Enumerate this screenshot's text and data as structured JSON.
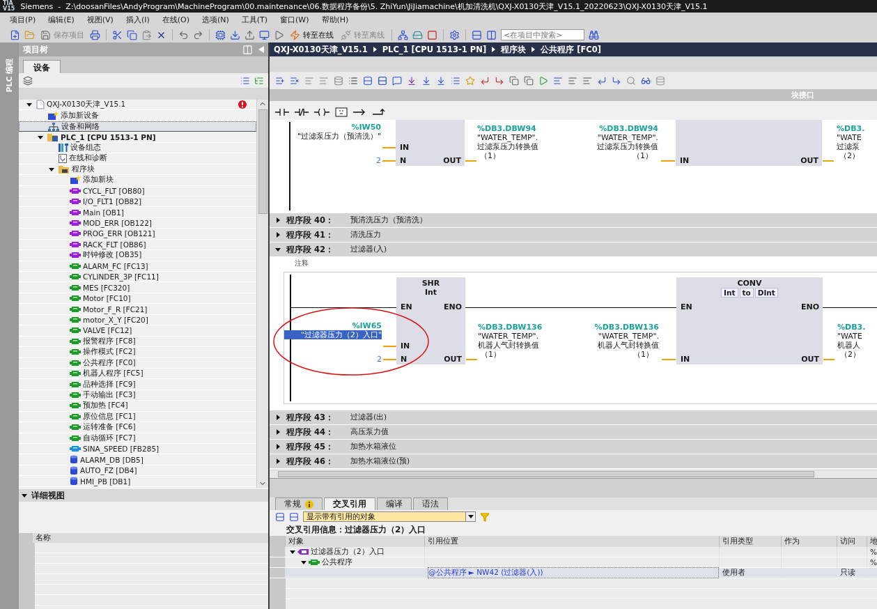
{
  "window": {
    "logo": [
      "TIA",
      "V15"
    ],
    "title": "Siemens  -  Z:\\doosanFiles\\AndyProgram\\MachineProgram\\00.maintenance\\06.数据程序备份\\5. ZhiYun\\JiJiamachine\\机加清洗机\\QXJ-X0130天津_V15.1_20220623\\QXJ-X0130天津_V15.1"
  },
  "menu": [
    "项目(P)",
    "编辑(E)",
    "视图(V)",
    "插入(I)",
    "在线(O)",
    "选项(N)",
    "工具(T)",
    "窗口(W)",
    "帮助(H)"
  ],
  "toolbar": {
    "buttons": [
      {
        "label": "保存项目",
        "disabled": true
      },
      {
        "label": "转至在线",
        "disabled": false
      },
      {
        "label": "转至离线",
        "disabled": true
      }
    ],
    "search": {
      "placeholder": "<在项目中搜索>"
    }
  },
  "side_tab": "PLC 编程",
  "project_tree": {
    "title": "项目树",
    "tabs": [
      {
        "label": "设备",
        "selected": true
      }
    ],
    "items": [
      {
        "label": "QXJ-X0130天津_V15.1",
        "kind": "project",
        "expanded": true,
        "error": true,
        "selected": false,
        "children": [
          {
            "label": "添加新设备",
            "kind": "add",
            "selected": false
          },
          {
            "label": "设备和网络",
            "kind": "network",
            "selected": true
          },
          {
            "label": "PLC_1 [CPU 1513-1 PN]",
            "kind": "plc",
            "expanded": true,
            "selected": false,
            "children": [
              {
                "label": "设备组态",
                "kind": "config",
                "selected": false
              },
              {
                "label": "在线和诊断",
                "kind": "diag",
                "selected": false
              },
              {
                "label": "程序块",
                "kind": "folder",
                "expanded": true,
                "selected": false,
                "children": [
                  {
                    "label": "添加新块",
                    "kind": "add",
                    "selected": false
                  },
                  {
                    "label": "CYCL_FLT [OB80]",
                    "kind": "ob",
                    "selected": false
                  },
                  {
                    "label": "I/O_FLT1 [OB82]",
                    "kind": "ob",
                    "selected": false
                  },
                  {
                    "label": "Main [OB1]",
                    "kind": "ob",
                    "selected": false
                  },
                  {
                    "label": "MOD_ERR [OB122]",
                    "kind": "ob",
                    "selected": false
                  },
                  {
                    "label": "PROG_ERR [OB121]",
                    "kind": "ob",
                    "selected": false
                  },
                  {
                    "label": "RACK_FLT [OB86]",
                    "kind": "ob",
                    "selected": false
                  },
                  {
                    "label": "时钟修改 [OB35]",
                    "kind": "ob",
                    "selected": false
                  },
                  {
                    "label": "ALARM_FC [FC13]",
                    "kind": "fc",
                    "selected": false
                  },
                  {
                    "label": "CYLINDER_3P [FC11]",
                    "kind": "fc",
                    "selected": false
                  },
                  {
                    "label": "MES [FC320]",
                    "kind": "fc",
                    "selected": false
                  },
                  {
                    "label": "Motor [FC10]",
                    "kind": "fc",
                    "selected": false
                  },
                  {
                    "label": "Motor_F_R [FC21]",
                    "kind": "fc",
                    "selected": false
                  },
                  {
                    "label": "motor_X_Y [FC20]",
                    "kind": "fc",
                    "selected": false
                  },
                  {
                    "label": "VALVE [FC12]",
                    "kind": "fc",
                    "selected": false
                  },
                  {
                    "label": "报警程序 [FC8]",
                    "kind": "fc",
                    "selected": false
                  },
                  {
                    "label": "操作模式 [FC2]",
                    "kind": "fc",
                    "selected": false
                  },
                  {
                    "label": "公共程序 [FC0]",
                    "kind": "fc",
                    "selected": false
                  },
                  {
                    "label": "机器人程序 [FC5]",
                    "kind": "fc",
                    "selected": false
                  },
                  {
                    "label": "品种选择 [FC9]",
                    "kind": "fc",
                    "selected": false
                  },
                  {
                    "label": "手动输出 [FC3]",
                    "kind": "fc",
                    "selected": false
                  },
                  {
                    "label": "预加热 [FC4]",
                    "kind": "fc",
                    "selected": false
                  },
                  {
                    "label": "原位信息 [FC1]",
                    "kind": "fc",
                    "selected": false
                  },
                  {
                    "label": "运转准备 [FC6]",
                    "kind": "fc",
                    "selected": false
                  },
                  {
                    "label": "自动循环 [FC7]",
                    "kind": "fc",
                    "selected": false
                  },
                  {
                    "label": "SINA_SPEED [FB285]",
                    "kind": "fb",
                    "selected": false
                  },
                  {
                    "label": "ALARM_DB [DB5]",
                    "kind": "db",
                    "selected": false
                  },
                  {
                    "label": "AUTO_FZ [DB4]",
                    "kind": "db",
                    "selected": false
                  },
                  {
                    "label": "HMI_PB [DB1]",
                    "kind": "db",
                    "selected": false
                  }
                ]
              }
            ]
          }
        ]
      }
    ]
  },
  "detail_view": {
    "title": "详细视图",
    "expanded": true,
    "columns": [
      "名称"
    ]
  },
  "editor": {
    "breadcrumb": [
      "QXJ-X0130天津_V15.1",
      "PLC_1 [CPU 1513-1 PN]",
      "程序块",
      "公共程序 [FC0]"
    ],
    "interface_label": "块接口",
    "partial_network": {
      "left_box": {
        "in_pins": [
          {
            "pin": "IN",
            "address": "%IW50",
            "symbol": "\"过滤泵压力（预清洗）\"",
            "selected": false
          },
          {
            "pin": "N",
            "value": "2"
          }
        ],
        "out_pin": "OUT"
      },
      "left_out": {
        "address": "%DB3.DBW94",
        "symbol": "\"WATER_TEMP\".",
        "member": "过滤泵压力转换值",
        "index": "（1）"
      },
      "right_box": {
        "in_pin": "IN",
        "out_pin": "OUT"
      },
      "right_in": {
        "address": "%DB3.DBW94",
        "symbol": "\"WATER_TEMP\".",
        "member": "过滤泵压力转换值",
        "index": "（1）"
      },
      "right_out": {
        "address": "%DB3.",
        "symbol": "\"WATE",
        "member": "过滤泵",
        "index": "（2）"
      }
    },
    "networks": [
      {
        "label": "程序段 40：",
        "title": "预清洗压力（预清洗）",
        "expanded": false
      },
      {
        "label": "程序段 41：",
        "title": "清洗压力",
        "expanded": false
      },
      {
        "label": "程序段 42：",
        "title": "过滤器(入)",
        "expanded": true,
        "comment": "注释",
        "ladder": {
          "left_box": {
            "title": "SHR",
            "subtitle": "Int",
            "en": "EN",
            "eno": "ENO",
            "in_pins": [
              {
                "pin": "IN",
                "address": "%IW65",
                "symbol": "\"过滤器压力（2）入口\"",
                "selected": true
              },
              {
                "pin": "N",
                "value": "2"
              }
            ],
            "out_pin": "OUT"
          },
          "left_out": {
            "address": "%DB3.DBW136",
            "symbol": "\"WATER_TEMP\".",
            "member": "机器人气封转换值",
            "index": "（1）"
          },
          "right_box": {
            "title": "CONV",
            "types": [
              "Int",
              "to",
              "DInt"
            ],
            "en": "EN",
            "eno": "ENO",
            "in_pin": "IN",
            "out_pin": "OUT"
          },
          "right_in": {
            "address": "%DB3.DBW136",
            "symbol": "\"WATER_TEMP\".",
            "member": "机器人气封转换值",
            "index": "（1）"
          },
          "right_out": {
            "address": "%DB3.",
            "symbol": "\"WATE",
            "member": "机器人",
            "index": "（2）"
          }
        }
      },
      {
        "label": "程序段 43：",
        "title": "过滤器(出)",
        "expanded": false
      },
      {
        "label": "程序段 44：",
        "title": "高压泵力值",
        "expanded": false
      },
      {
        "label": "程序段 45：",
        "title": "加热水箱液位",
        "expanded": false
      },
      {
        "label": "程序段 46：",
        "title": "加热水箱液位(预)",
        "expanded": false
      }
    ]
  },
  "inspector": {
    "tabs": [
      {
        "label": "常规",
        "selected": false,
        "info": true
      },
      {
        "label": "交叉引用",
        "selected": true,
        "info": false
      },
      {
        "label": "编译",
        "selected": false,
        "info": false
      },
      {
        "label": "语法",
        "selected": false,
        "info": false
      }
    ],
    "filter": "显示带有引用的对象",
    "title": "交叉引用信息：过滤器压力（2）入口",
    "columns": [
      "对象",
      "引用位置",
      "引用类型",
      "作为",
      "访问",
      "地"
    ],
    "rows": [
      {
        "object": "过滤器压力（2）入口",
        "kind": "tag",
        "expanded": true,
        "address": "%",
        "selected": false,
        "children": [
          {
            "object": "公共程序",
            "kind": "fc",
            "expanded": true,
            "address": "%",
            "selected": false,
            "children": [
              {
                "location": "@公共程序 ► NW42 (过滤器(入))",
                "ref_type": "使用者",
                "access": "只读",
                "selected": true
              }
            ]
          }
        ]
      }
    ]
  }
}
